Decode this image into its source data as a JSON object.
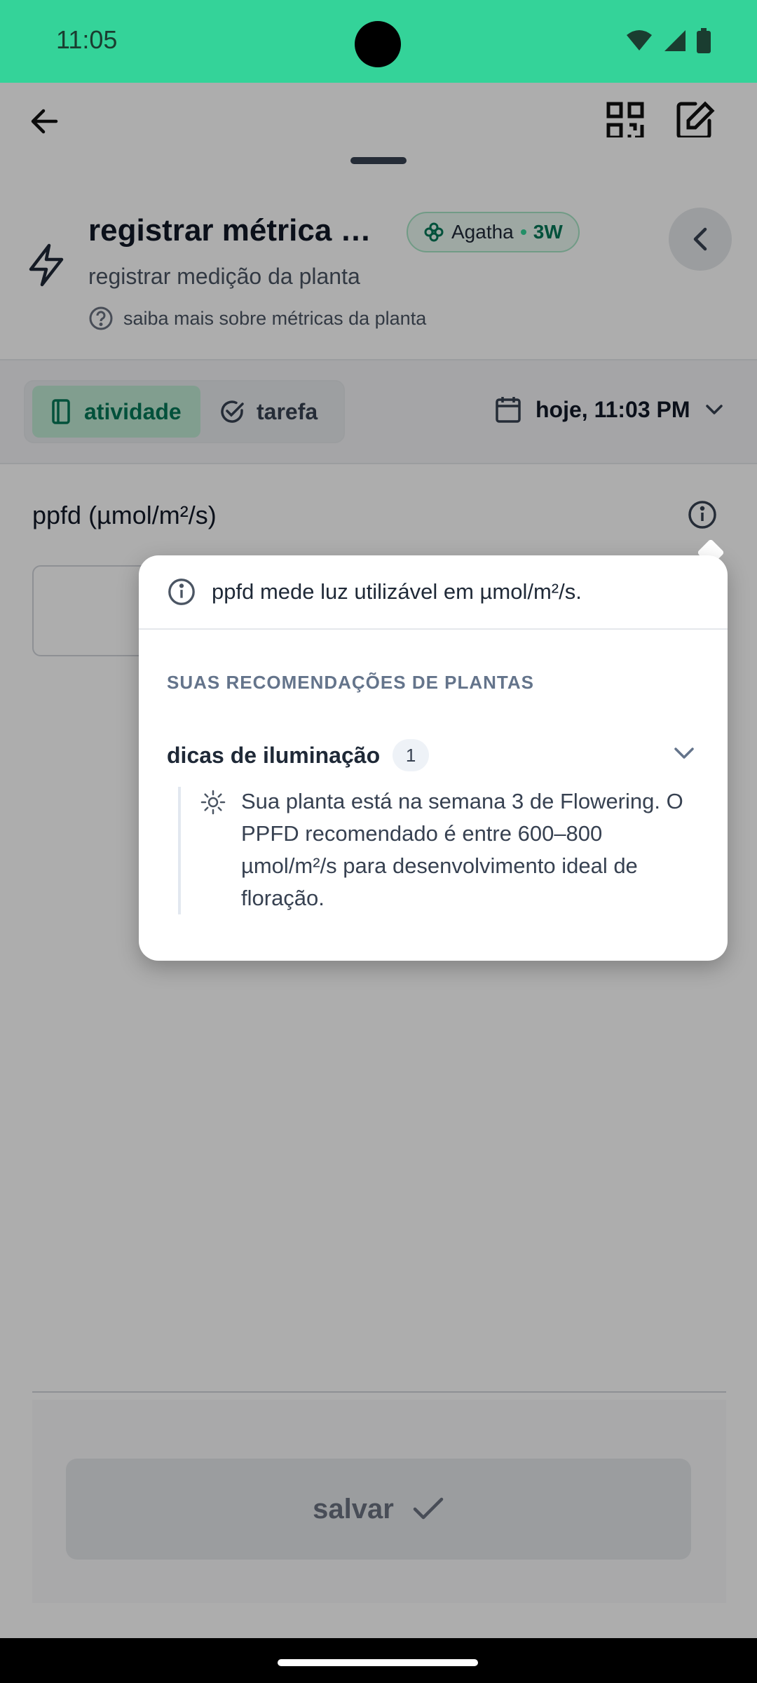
{
  "status_bar": {
    "time": "11:05"
  },
  "header": {
    "title": "registrar métrica …",
    "subtitle": "registrar medição da planta",
    "learn_more": "saiba mais sobre métricas da planta",
    "plant_chip": {
      "name": "Agatha",
      "week": "3W"
    }
  },
  "mode_toggle": {
    "activity": "atividade",
    "task": "tarefa"
  },
  "date_selector": {
    "value": "hoje, 11:03 PM"
  },
  "field": {
    "label": "ppfd (µmol/m²/s)",
    "value": ""
  },
  "popover": {
    "info": "ppfd mede luz utilizável em µmol/m²/s.",
    "section_title": "SUAS RECOMENDAÇÕES DE PLANTAS",
    "tips": {
      "title": "dicas de iluminação",
      "count": "1",
      "text": "Sua planta está na semana 3 de Flowering. O PPFD recomendado é entre 600–800 µmol/m²/s para desenvolvimento ideal de floração."
    }
  },
  "footer": {
    "save_label": "salvar"
  },
  "colors": {
    "accent": "#34d399",
    "accent_dark": "#047857",
    "scrim": "rgba(0,0,0,0.32)"
  }
}
